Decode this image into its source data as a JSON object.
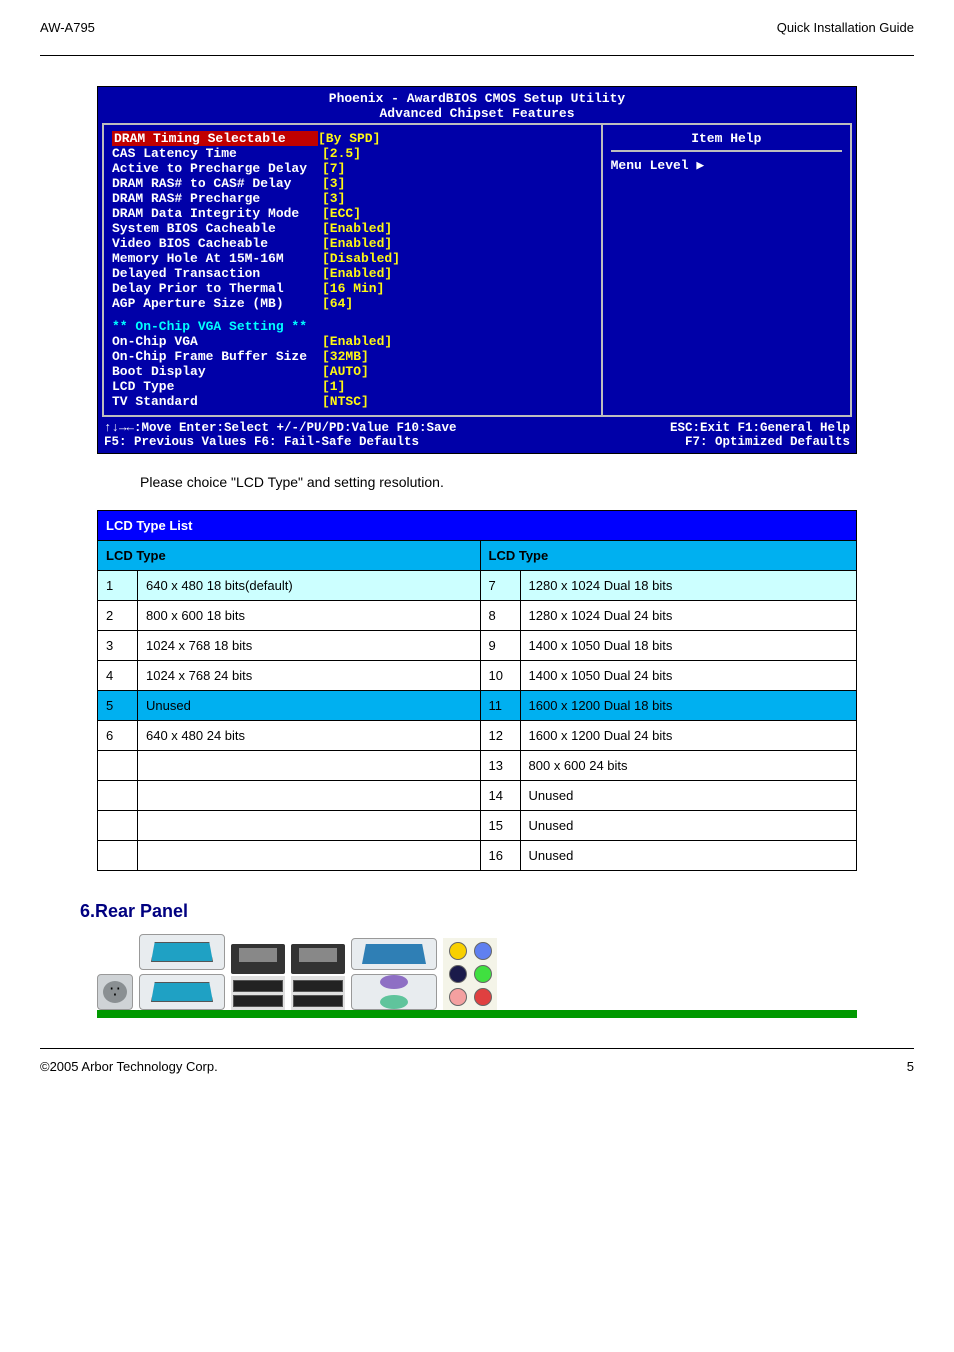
{
  "header": {
    "left": "AW-A795",
    "right": "Quick Installation Guide"
  },
  "bios": {
    "title1": "Phoenix - AwardBIOS CMOS Setup Utility",
    "title2": "Advanced Chipset Features",
    "rows": [
      {
        "label": "DRAM Timing Selectable",
        "val": "[By SPD]",
        "hl": true
      },
      {
        "label": "CAS Latency Time",
        "val": "[2.5]"
      },
      {
        "label": "Active to Precharge Delay",
        "val": "[7]"
      },
      {
        "label": "DRAM RAS# to CAS# Delay",
        "val": "[3]"
      },
      {
        "label": "DRAM RAS# Precharge",
        "val": "[3]"
      },
      {
        "label": "DRAM Data Integrity Mode",
        "val": "[ECC]"
      },
      {
        "label": "System BIOS Cacheable",
        "val": "[Enabled]"
      },
      {
        "label": "Video  BIOS Cacheable",
        "val": "[Enabled]"
      },
      {
        "label": "Memory Hole At 15M-16M",
        "val": "[Disabled]"
      },
      {
        "label": "Delayed Transaction",
        "val": "[Enabled]"
      },
      {
        "label": "Delay Prior to Thermal",
        "val": "[16 Min]"
      },
      {
        "label": "AGP Aperture Size (MB)",
        "val": "[64]"
      }
    ],
    "section": "** On-Chip VGA Setting **",
    "rows2": [
      {
        "label": "On-Chip VGA",
        "val": "[Enabled]"
      },
      {
        "label": "On-Chip Frame Buffer Size",
        "val": "[32MB]"
      },
      {
        "label": "Boot Display",
        "val": "[AUTO]"
      },
      {
        "label": "LCD Type",
        "val": "[1]"
      },
      {
        "label": "TV Standard",
        "val": "[NTSC]"
      }
    ],
    "help_title": "Item Help",
    "menu_level": "Menu Level   ▶",
    "foot1_left": "↑↓→←:Move  Enter:Select  +/-/PU/PD:Value  F10:Save",
    "foot1_right": "ESC:Exit  F1:General Help",
    "foot2_left": "F5: Previous Values    F6: Fail-Safe Defaults",
    "foot2_right": "F7: Optimized Defaults"
  },
  "table_caption": "Please choice \"LCD Type\" and setting resolution.",
  "table": {
    "head1": "LCD Type List",
    "head_left": "LCD Type",
    "head_right": "LCD Type",
    "rows": [
      {
        "ln": "1",
        "l": "640 x 480 18 bits(default)",
        "rn": "7",
        "r": "1280 x 1024  Dual 18 bits",
        "cls": "row-default"
      },
      {
        "ln": "2",
        "l": "800 x 600 18 bits",
        "rn": "8",
        "r": "1280 x 1024  Dual 24 bits",
        "cls": ""
      },
      {
        "ln": "3",
        "l": "1024 x 768 18 bits",
        "rn": "9",
        "r": "1400 x 1050  Dual 18 bits",
        "cls": ""
      },
      {
        "ln": "4",
        "l": "1024 x 768 24 bits",
        "rn": "10",
        "r": "1400 x 1050  Dual 24 bits",
        "cls": ""
      },
      {
        "ln": "5",
        "l": "Unused",
        "rn": "11",
        "r": "1600 x 1200  Dual 18 bits",
        "cls": "row-unused"
      },
      {
        "ln": "6",
        "l": "640 x 480 24 bits",
        "rn": "12",
        "r": "1600 x 1200  Dual 24 bits",
        "cls": ""
      },
      {
        "ln": "",
        "l": "",
        "rn": "13",
        "r": "800 x 600 24 bits",
        "cls": ""
      },
      {
        "ln": "",
        "l": "",
        "rn": "14",
        "r": "Unused",
        "cls": ""
      },
      {
        "ln": "",
        "l": "",
        "rn": "15",
        "r": "Unused",
        "cls": ""
      },
      {
        "ln": "",
        "l": "",
        "rn": "16",
        "r": "Unused",
        "cls": ""
      }
    ]
  },
  "rear_heading": "6.Rear Panel",
  "footer": {
    "left": "©2005 Arbor Technology Corp.",
    "right": "5"
  },
  "icons": {
    "arrow": "▶"
  }
}
